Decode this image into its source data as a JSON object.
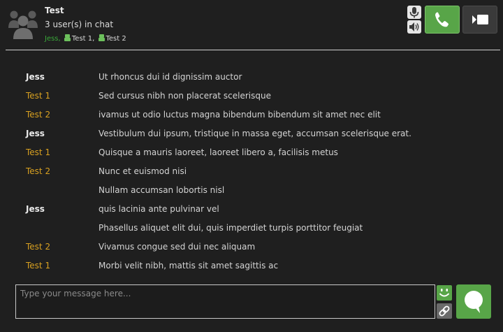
{
  "header": {
    "title": "Test",
    "user_count": "3 user(s) in chat",
    "participants": [
      {
        "name": "Jess,",
        "is_self": true
      },
      {
        "name": "Test 1,",
        "is_self": false
      },
      {
        "name": "Test 2",
        "is_self": false
      }
    ]
  },
  "controls": {
    "mic": "microphone-icon",
    "speaker": "speaker-icon",
    "call": "phone-icon",
    "video": "video-camera-icon"
  },
  "messages": [
    {
      "sender": "Jess",
      "is_self": true,
      "text": "Ut rhoncus dui id dignissim auctor"
    },
    {
      "sender": "Test 1",
      "is_self": false,
      "text": "Sed cursus nibh non placerat scelerisque"
    },
    {
      "sender": "Test 2",
      "is_self": false,
      "text": "ivamus ut odio luctus magna bibendum bibendum sit amet nec elit"
    },
    {
      "sender": "Jess",
      "is_self": true,
      "text": "Vestibulum dui ipsum, tristique in massa eget, accumsan scelerisque erat."
    },
    {
      "sender": "Test 1",
      "is_self": false,
      "text": "Quisque a mauris laoreet, laoreet libero a, facilisis metus"
    },
    {
      "sender": "Test 2",
      "is_self": false,
      "text": "Nunc et euismod nisi"
    },
    {
      "sender": "",
      "is_self": false,
      "text": "Nullam accumsan lobortis nisl"
    },
    {
      "sender": "Jess",
      "is_self": true,
      "text": "quis lacinia ante pulvinar vel"
    },
    {
      "sender": "",
      "is_self": false,
      "text": "Phasellus aliquet elit dui, quis imperdiet turpis porttitor feugiat"
    },
    {
      "sender": "Test 2",
      "is_self": false,
      "text": "Vivamus congue sed dui nec aliquam"
    },
    {
      "sender": "Test 1",
      "is_self": false,
      "text": "Morbi velit nibh, mattis sit amet sagittis ac"
    }
  ],
  "composer": {
    "placeholder": "Type your message here...",
    "value": ""
  },
  "colors": {
    "accent_green": "#58a548",
    "other_sender": "#d8a020",
    "self_participant": "#39a939",
    "background": "#1f1f1f"
  }
}
